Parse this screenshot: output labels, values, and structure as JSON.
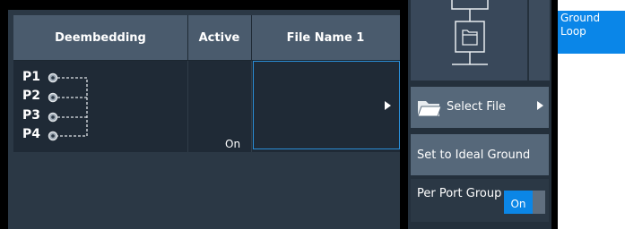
{
  "table": {
    "headers": {
      "deembedding": "Deembedding",
      "active": "Active",
      "file_name": "File Name 1"
    },
    "ports": [
      "P1",
      "P2",
      "P3",
      "P4"
    ],
    "active_value": "On",
    "file_value": ""
  },
  "side": {
    "select_file_label": "Select File",
    "ideal_ground_label": "Set to Ideal Ground",
    "per_port_group_label": "Per Port Group",
    "per_port_group_value": "On"
  },
  "tabs": {
    "ground_loop_label": "Ground Loop"
  },
  "colors": {
    "accent": "#0a86e8",
    "header_bg": "#4a5b6d",
    "button_bg": "#56687a"
  }
}
